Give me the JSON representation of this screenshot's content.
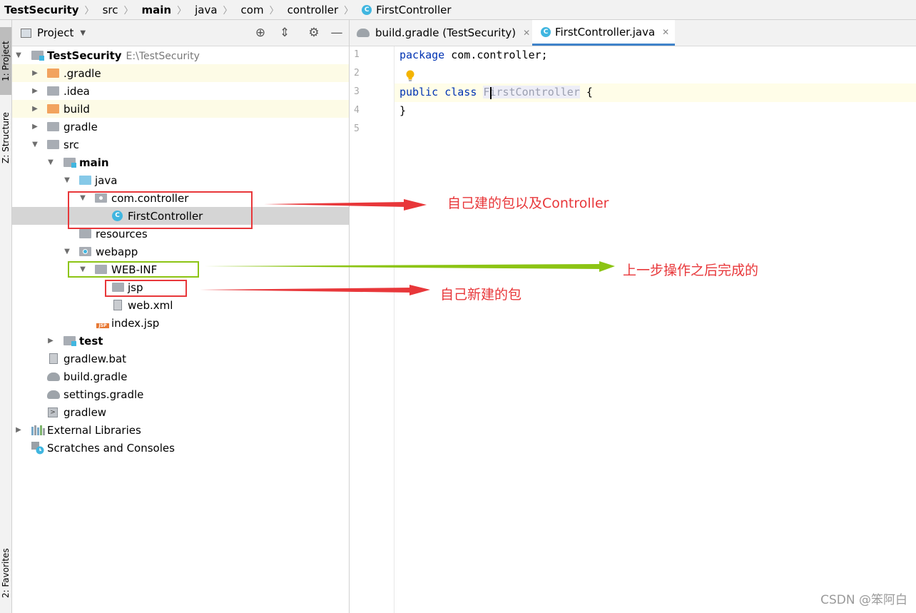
{
  "breadcrumb": {
    "items": [
      "TestSecurity",
      "src",
      "main",
      "java",
      "com",
      "controller",
      "FirstController"
    ]
  },
  "side_tabs": {
    "project": "1: Project",
    "structure": "Z: Structure",
    "favorites": "2: Favorites"
  },
  "project_panel": {
    "title": "Project",
    "tree": [
      {
        "label": "TestSecurity",
        "path": "E:\\TestSecurity"
      },
      {
        "label": ".gradle"
      },
      {
        "label": ".idea"
      },
      {
        "label": "build"
      },
      {
        "label": "gradle"
      },
      {
        "label": "src"
      },
      {
        "label": "main"
      },
      {
        "label": "java"
      },
      {
        "label": "com.controller"
      },
      {
        "label": "FirstController"
      },
      {
        "label": "resources"
      },
      {
        "label": "webapp"
      },
      {
        "label": "WEB-INF"
      },
      {
        "label": "jsp"
      },
      {
        "label": "web.xml"
      },
      {
        "label": "index.jsp"
      },
      {
        "label": "test"
      },
      {
        "label": "gradlew.bat"
      },
      {
        "label": "build.gradle"
      },
      {
        "label": "settings.gradle"
      },
      {
        "label": "gradlew"
      },
      {
        "label": "External Libraries"
      },
      {
        "label": "Scratches and Consoles"
      }
    ]
  },
  "editor": {
    "tabs": [
      {
        "label": "build.gradle (TestSecurity)"
      },
      {
        "label": "FirstController.java"
      }
    ],
    "line_numbers": [
      "1",
      "2",
      "3",
      "4",
      "5"
    ],
    "code": {
      "line1_kw": "package",
      "line1_rest": " com.controller;",
      "line3_kw1": "public",
      "line3_kw2": "class",
      "line3_class": "FirstController",
      "line3_rest": " {",
      "line4": "}"
    }
  },
  "annotations": {
    "note1": "自己建的包以及Controller",
    "note2": "上一步操作之后完成的",
    "note3": "自己新建的包",
    "colors": {
      "red": "#e8373a",
      "green": "#8cc414"
    }
  },
  "watermark": "CSDN @笨阿白"
}
